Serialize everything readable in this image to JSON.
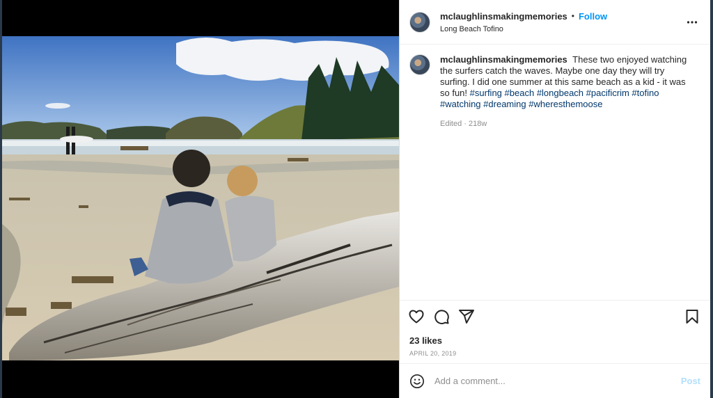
{
  "post": {
    "username": "mclaughlinsmakingmemories",
    "follow_label": "Follow",
    "separator": "•",
    "location": "Long Beach Tofino",
    "caption": {
      "username": "mclaughlinsmakingmemories",
      "text": "These two enjoyed watching the surfers catch the waves. Maybe one day they will try surfing. I did one summer at this same beach as a kid - it was so fun!",
      "hashtags": [
        "#surfing",
        "#beach",
        "#longbeach",
        "#pacificrim",
        "#tofino",
        "#watching",
        "#dreaming",
        "#wheresthemoose"
      ]
    },
    "edited_meta": "Edited · 218w",
    "likes": "23 likes",
    "date": "April 20, 2019"
  },
  "comment": {
    "placeholder": "Add a comment...",
    "post_label": "Post"
  },
  "icons": {
    "more": "more-options-icon",
    "like": "heart-icon",
    "comment": "comment-bubble-icon",
    "share": "paper-plane-icon",
    "save": "bookmark-icon",
    "emoji": "smiley-icon"
  },
  "colors": {
    "accent": "#0095f6",
    "hashtag": "#00376b",
    "muted": "#8e8e8e",
    "post_disabled": "#b2dffc"
  }
}
